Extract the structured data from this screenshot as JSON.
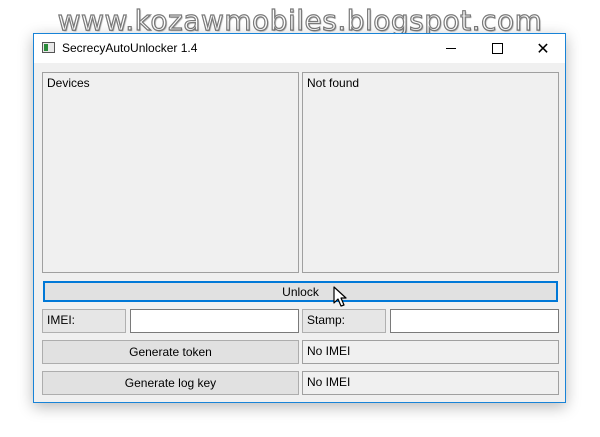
{
  "watermark": "www.kozawmobiles.blogspot.com",
  "window": {
    "title": "SecrecyAutoUnlocker 1.4",
    "controls": {
      "minimize_icon": "minimize-icon",
      "maximize_icon": "maximize-icon",
      "close_icon": "close-icon",
      "close_glyph": "✕"
    }
  },
  "panels": {
    "devices_label": "Devices",
    "status_label": "Not found"
  },
  "buttons": {
    "unlock": "Unlock",
    "generate_token": "Generate token",
    "generate_log_key": "Generate log key"
  },
  "fields": {
    "imei_label": "IMEI:",
    "imei_value": "",
    "stamp_label": "Stamp:",
    "stamp_value": ""
  },
  "status": {
    "token_result": "No IMEI",
    "log_key_result": "No IMEI"
  },
  "colors": {
    "accent": "#0078d7",
    "window_border": "#1883d7",
    "window_bg": "#f0f0f0"
  }
}
